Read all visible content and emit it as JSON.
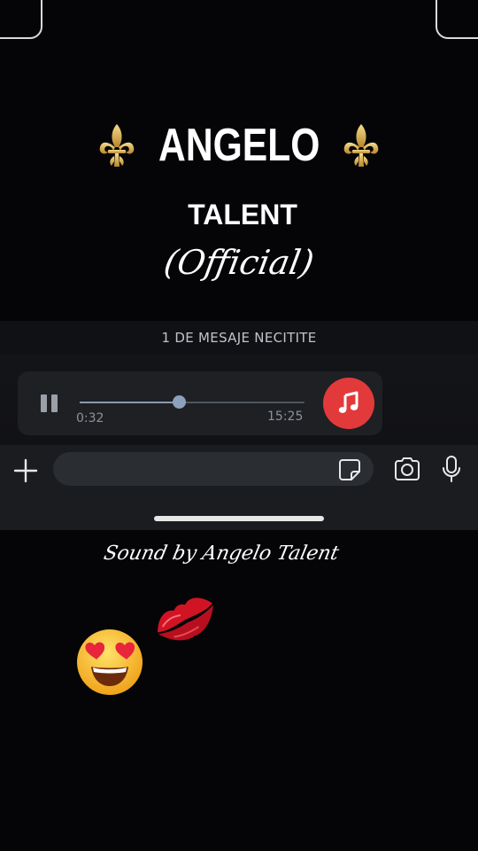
{
  "overlay": {
    "brand_name": "ANGELO",
    "brand_line2": "TALENT",
    "brand_line3": "(Official)",
    "credit": "Sound by Angelo Talent",
    "decor_icons": [
      "fleur-de-lis-icon",
      "kiss-lips-icon",
      "heart-eyes-emoji-icon"
    ]
  },
  "chat": {
    "unread_banner": "1 DE MESAJE NECITITE",
    "voice_message": {
      "elapsed": "0:32",
      "duration": "15:25",
      "progress": 0.44,
      "state_icon": "pause-icon",
      "badge_icon": "music-note-icon",
      "badge_color": "#e23a3a"
    }
  },
  "input_bar": {
    "value": "",
    "icons": [
      "plus-icon",
      "sticker-icon",
      "camera-icon",
      "microphone-icon"
    ]
  }
}
